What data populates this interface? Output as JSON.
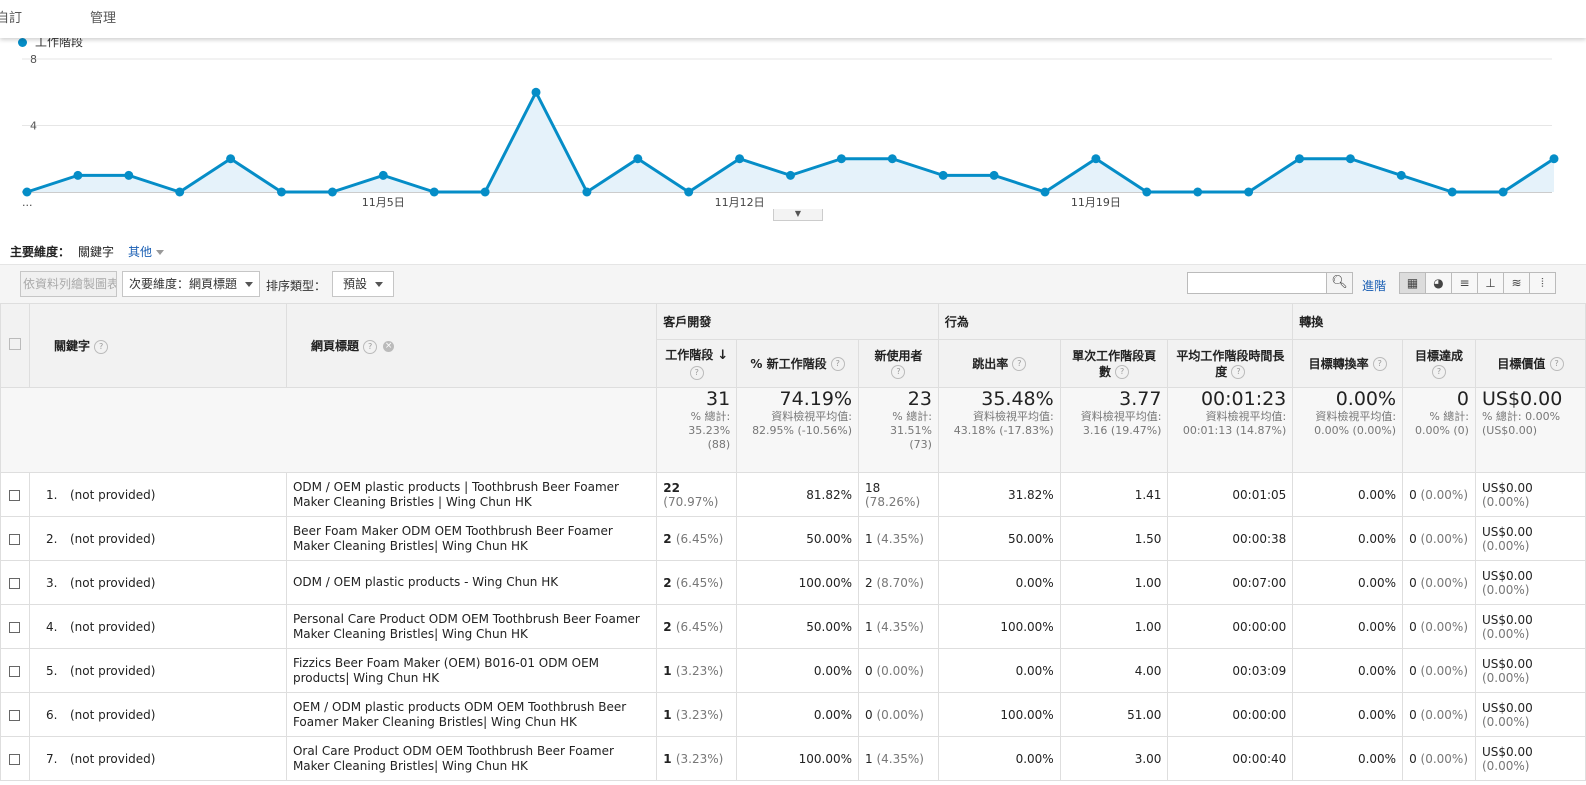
{
  "topnav": {
    "item1": "自訂",
    "item2": "管理"
  },
  "chart_data": {
    "type": "area",
    "series": [
      {
        "name": "工作階段",
        "values": [
          0,
          1,
          1,
          0,
          2,
          0,
          0,
          1,
          0,
          0,
          6,
          0,
          2,
          0,
          2,
          1,
          2,
          2,
          1,
          1,
          0,
          2,
          0,
          0,
          0,
          2,
          2,
          1,
          0,
          0,
          2
        ]
      }
    ],
    "x_tick_labels": [
      "...",
      "11月5日",
      "11月12日",
      "11月19日"
    ],
    "y_tick_labels": [
      "4",
      "8"
    ],
    "ylim": [
      0,
      8
    ],
    "color": "#058dc7",
    "grid": true
  },
  "dimension": {
    "label": "主要維度：",
    "current": "關鍵字",
    "other": "其他"
  },
  "toolbar": {
    "plot_rows": "依資料列繪製圖表",
    "secondary": "次要維度：網頁標題",
    "sort_label": "排序類型：",
    "sort_value": "預設",
    "advanced": "進階"
  },
  "table": {
    "col_keyword": "關鍵字",
    "col_title": "網頁標題",
    "groups": {
      "acq": "客戶開發",
      "beh": "行為",
      "conv": "轉換"
    },
    "metrics": [
      "工作階段",
      "% 新工作階段",
      "新使用者",
      "跳出率",
      "單次工作階段頁數",
      "平均工作階段時間長度",
      "目標轉換率",
      "目標達成",
      "目標價值"
    ],
    "totals": [
      {
        "main": "31",
        "sub": "% 總計: 35.23% (88)"
      },
      {
        "main": "74.19%",
        "sub": "資料檢視平均值: 82.95% (-10.56%)"
      },
      {
        "main": "23",
        "sub": "% 總計: 31.51% (73)"
      },
      {
        "main": "35.48%",
        "sub": "資料檢視平均值: 43.18% (-17.83%)"
      },
      {
        "main": "3.77",
        "sub": "資料檢視平均值: 3.16 (19.47%)"
      },
      {
        "main": "00:01:23",
        "sub": "資料檢視平均值: 00:01:13 (14.87%)"
      },
      {
        "main": "0.00%",
        "sub": "資料檢視平均值: 0.00% (0.00%)"
      },
      {
        "main": "0",
        "sub": "% 總計: 0.00% (0)"
      },
      {
        "main": "US$0.00",
        "sub": "% 總計: 0.00% (US$0.00)"
      }
    ],
    "rows": [
      {
        "rank": "1.",
        "keyword": "(not provided)",
        "title": "ODM / OEM plastic products | Toothbrush Beer Foamer Maker Cleaning Bristles | Wing Chun HK",
        "sessions": "22",
        "sessions_pct": "(70.97%)",
        "new_sess": "81.82%",
        "new_users": "18",
        "new_users_pct": "(78.26%)",
        "bounce": "31.82%",
        "pages": "1.41",
        "duration": "00:01:05",
        "conv_rate": "0.00%",
        "goal": "0",
        "goal_pct": "(0.00%)",
        "value": "US$0.00",
        "value_pct": "(0.00%)"
      },
      {
        "rank": "2.",
        "keyword": "(not provided)",
        "title": "Beer Foam Maker ODM OEM Toothbrush Beer Foamer Maker Cleaning Bristles| Wing Chun HK",
        "sessions": "2",
        "sessions_pct": "(6.45%)",
        "new_sess": "50.00%",
        "new_users": "1",
        "new_users_pct": "(4.35%)",
        "bounce": "50.00%",
        "pages": "1.50",
        "duration": "00:00:38",
        "conv_rate": "0.00%",
        "goal": "0",
        "goal_pct": "(0.00%)",
        "value": "US$0.00",
        "value_pct": "(0.00%)"
      },
      {
        "rank": "3.",
        "keyword": "(not provided)",
        "title": "ODM / OEM plastic products - Wing Chun HK",
        "sessions": "2",
        "sessions_pct": "(6.45%)",
        "new_sess": "100.00%",
        "new_users": "2",
        "new_users_pct": "(8.70%)",
        "bounce": "0.00%",
        "pages": "1.00",
        "duration": "00:07:00",
        "conv_rate": "0.00%",
        "goal": "0",
        "goal_pct": "(0.00%)",
        "value": "US$0.00",
        "value_pct": "(0.00%)"
      },
      {
        "rank": "4.",
        "keyword": "(not provided)",
        "title": "Personal Care Product ODM OEM Toothbrush Beer Foamer Maker Cleaning Bristles| Wing Chun HK",
        "sessions": "2",
        "sessions_pct": "(6.45%)",
        "new_sess": "50.00%",
        "new_users": "1",
        "new_users_pct": "(4.35%)",
        "bounce": "100.00%",
        "pages": "1.00",
        "duration": "00:00:00",
        "conv_rate": "0.00%",
        "goal": "0",
        "goal_pct": "(0.00%)",
        "value": "US$0.00",
        "value_pct": "(0.00%)"
      },
      {
        "rank": "5.",
        "keyword": "(not provided)",
        "title": "Fizzics Beer Foam Maker (OEM) B016-01 ODM OEM products| Wing Chun HK",
        "sessions": "1",
        "sessions_pct": "(3.23%)",
        "new_sess": "0.00%",
        "new_users": "0",
        "new_users_pct": "(0.00%)",
        "bounce": "0.00%",
        "pages": "4.00",
        "duration": "00:03:09",
        "conv_rate": "0.00%",
        "goal": "0",
        "goal_pct": "(0.00%)",
        "value": "US$0.00",
        "value_pct": "(0.00%)"
      },
      {
        "rank": "6.",
        "keyword": "(not provided)",
        "title": "OEM / ODM plastic products ODM OEM Toothbrush Beer Foamer Maker Cleaning Bristles| Wing Chun HK",
        "sessions": "1",
        "sessions_pct": "(3.23%)",
        "new_sess": "0.00%",
        "new_users": "0",
        "new_users_pct": "(0.00%)",
        "bounce": "100.00%",
        "pages": "51.00",
        "duration": "00:00:00",
        "conv_rate": "0.00%",
        "goal": "0",
        "goal_pct": "(0.00%)",
        "value": "US$0.00",
        "value_pct": "(0.00%)"
      },
      {
        "rank": "7.",
        "keyword": "(not provided)",
        "title": "Oral Care Product ODM OEM Toothbrush Beer Foamer Maker Cleaning Bristles| Wing Chun HK",
        "sessions": "1",
        "sessions_pct": "(3.23%)",
        "new_sess": "100.00%",
        "new_users": "1",
        "new_users_pct": "(4.35%)",
        "bounce": "0.00%",
        "pages": "3.00",
        "duration": "00:00:40",
        "conv_rate": "0.00%",
        "goal": "0",
        "goal_pct": "(0.00%)",
        "value": "US$0.00",
        "value_pct": "(0.00%)"
      }
    ]
  }
}
